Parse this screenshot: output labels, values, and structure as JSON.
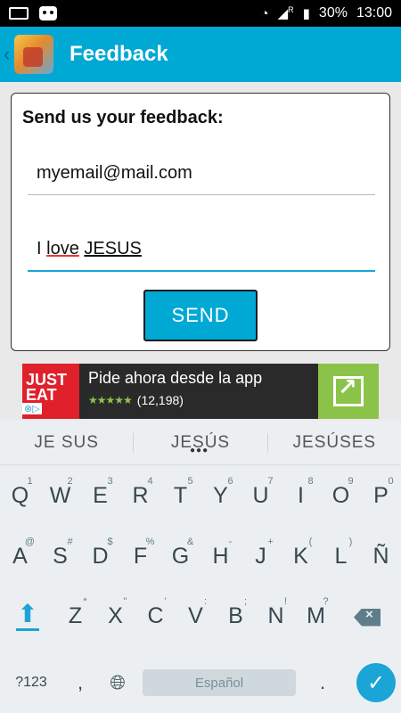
{
  "status_bar": {
    "battery": "30%",
    "time": "13:00",
    "icons": [
      "keyboard-icon",
      "cat-app-icon",
      "wifi-icon",
      "signal-icon",
      "battery-icon"
    ],
    "roaming": "R"
  },
  "app_bar": {
    "title": "Feedback",
    "back": "‹"
  },
  "form": {
    "title": "Send us your feedback:",
    "email_value": "myemail@mail.com",
    "message_word1": "I ",
    "message_word2": "love",
    "message_word3": " ",
    "message_word4": "JESUS",
    "send_label": "SEND"
  },
  "ad": {
    "logo_line1": "JUST",
    "logo_line2": "EAT",
    "headline": "Pide ahora desde la app",
    "stars": "★★★★★",
    "rating_count": "(12,198)"
  },
  "keyboard": {
    "suggestions": [
      "JE SUS",
      "JESÚS",
      "JESÚSES"
    ],
    "row1": [
      "Q",
      "W",
      "E",
      "R",
      "T",
      "Y",
      "U",
      "I",
      "O",
      "P"
    ],
    "row1_hints": [
      "1",
      "2",
      "3",
      "4",
      "5",
      "6",
      "7",
      "8",
      "9",
      "0"
    ],
    "row2": [
      "A",
      "S",
      "D",
      "F",
      "G",
      "H",
      "J",
      "K",
      "L",
      "Ñ"
    ],
    "row2_hints": [
      "@",
      "#",
      "$",
      "%",
      "&",
      "-",
      "+",
      "(",
      ")",
      ""
    ],
    "row3": [
      "Z",
      "X",
      "C",
      "V",
      "B",
      "N",
      "M"
    ],
    "row3_hints": [
      "*",
      "\"",
      "'",
      ":",
      ";",
      "!",
      "?"
    ],
    "mode_label": "?123",
    "comma": ",",
    "space_label": "Español",
    "period": ".",
    "enter_icon": "✓"
  },
  "colors": {
    "accent": "#00a8d4",
    "keyboard_accent": "#1ba4d6",
    "ad_logo": "#e0202b",
    "ad_action": "#8bc34a"
  }
}
